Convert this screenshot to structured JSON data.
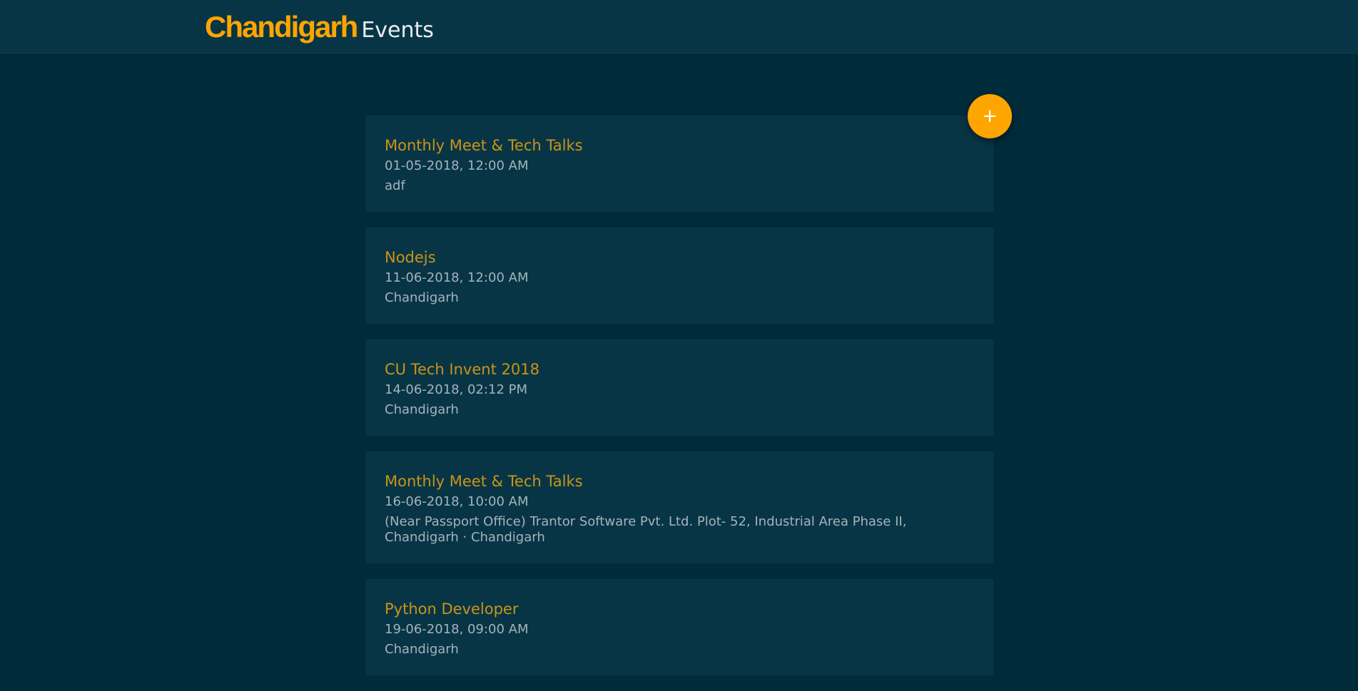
{
  "header": {
    "brand_city": "Chandigarh",
    "brand_suffix": "Events"
  },
  "fab": {
    "icon": "plus-icon",
    "glyph": "+"
  },
  "events": [
    {
      "title": "Monthly Meet & Tech Talks",
      "datetime": "01-05-2018, 12:00 AM",
      "location": "adf"
    },
    {
      "title": "Nodejs",
      "datetime": "11-06-2018, 12:00 AM",
      "location": "Chandigarh"
    },
    {
      "title": "CU Tech Invent 2018",
      "datetime": "14-06-2018, 02:12 PM",
      "location": "Chandigarh"
    },
    {
      "title": "Monthly Meet & Tech Talks",
      "datetime": "16-06-2018, 10:00 AM",
      "location": "(Near Passport Office) Trantor Software Pvt. Ltd. Plot- 52, Industrial Area Phase II, Chandigarh · Chandigarh"
    },
    {
      "title": "Python Developer",
      "datetime": "19-06-2018, 09:00 AM",
      "location": "Chandigarh"
    }
  ],
  "colors": {
    "background": "#002b3a",
    "card": "#083545",
    "accent": "#ffa500",
    "title": "#c99418",
    "text": "#a3b4bb"
  }
}
